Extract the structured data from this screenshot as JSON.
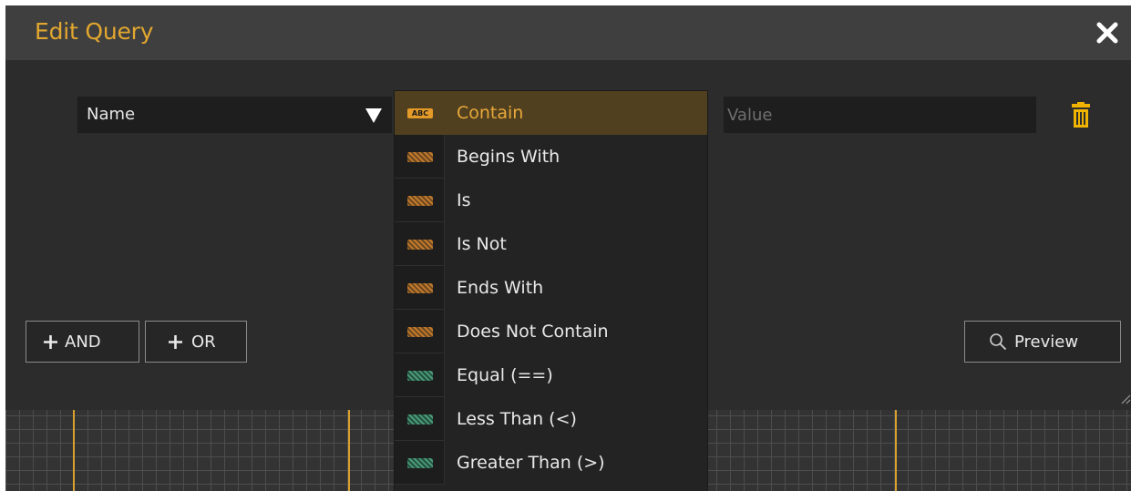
{
  "dialog": {
    "title": "Edit Query",
    "close_icon": "close-x-icon"
  },
  "condition": {
    "field_value": "Name",
    "field_arrow_icon": "triangle-down-icon",
    "value_placeholder": "Value",
    "delete_icon": "trash-icon"
  },
  "operators": [
    {
      "label": "Contain",
      "type": "string",
      "icon_text": "ABC",
      "selected": true
    },
    {
      "label": "Begins With",
      "type": "string",
      "selected": false
    },
    {
      "label": "Is",
      "type": "string",
      "selected": false
    },
    {
      "label": "Is Not",
      "type": "string",
      "selected": false
    },
    {
      "label": "Ends With",
      "type": "string",
      "selected": false
    },
    {
      "label": "Does Not Contain",
      "type": "string",
      "selected": false
    },
    {
      "label": "Equal (==)",
      "type": "number",
      "selected": false
    },
    {
      "label": "Less Than (<)",
      "type": "number",
      "selected": false
    },
    {
      "label": "Greater Than (>)",
      "type": "number",
      "selected": false
    }
  ],
  "buttons": {
    "and_label": "AND",
    "or_label": "OR",
    "preview_label": "Preview",
    "plus_icon": "plus-icon",
    "search_icon": "magnifier-icon"
  },
  "colors": {
    "accent": "#e2a72f",
    "dialog_bg": "#2c2c2c",
    "titlebar_bg": "#3f3f3f",
    "selected_row_bg": "#51401f",
    "string_type": "#c07a2c",
    "number_type": "#4a9a78"
  }
}
